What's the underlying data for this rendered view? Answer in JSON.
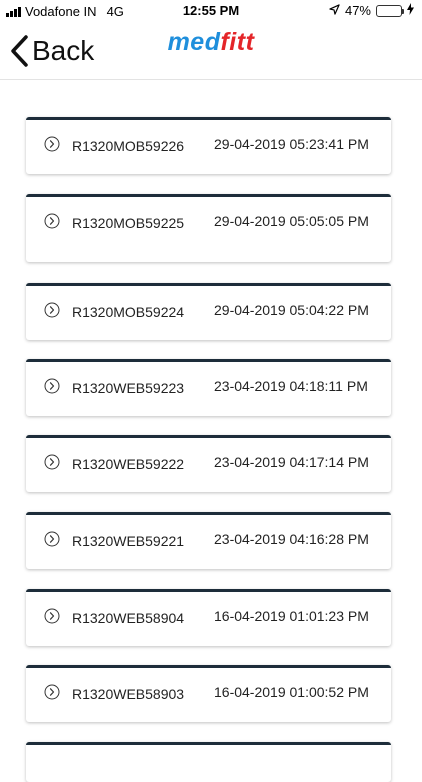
{
  "status": {
    "carrier": "Vodafone IN",
    "network": "4G",
    "time": "12:55 PM",
    "battery": "47%",
    "battery_level": 0.47
  },
  "nav": {
    "back_label": "Back",
    "logo_part1": "med",
    "logo_part2": "fitt"
  },
  "records": [
    {
      "id": "R1320MOB59226",
      "datetime": "29-04-2019 05:23:41 PM"
    },
    {
      "id": "R1320MOB59225",
      "datetime": "29-04-2019 05:05:05 PM"
    },
    {
      "id": "R1320MOB59224",
      "datetime": "29-04-2019 05:04:22 PM"
    },
    {
      "id": "R1320WEB59223",
      "datetime": "23-04-2019 04:18:11 PM"
    },
    {
      "id": "R1320WEB59222",
      "datetime": "23-04-2019 04:17:14 PM"
    },
    {
      "id": "R1320WEB59221",
      "datetime": "23-04-2019 04:16:28 PM"
    },
    {
      "id": "R1320WEB58904",
      "datetime": "16-04-2019 01:01:23 PM"
    },
    {
      "id": "R1320WEB58903",
      "datetime": "16-04-2019 01:00:52 PM"
    }
  ]
}
